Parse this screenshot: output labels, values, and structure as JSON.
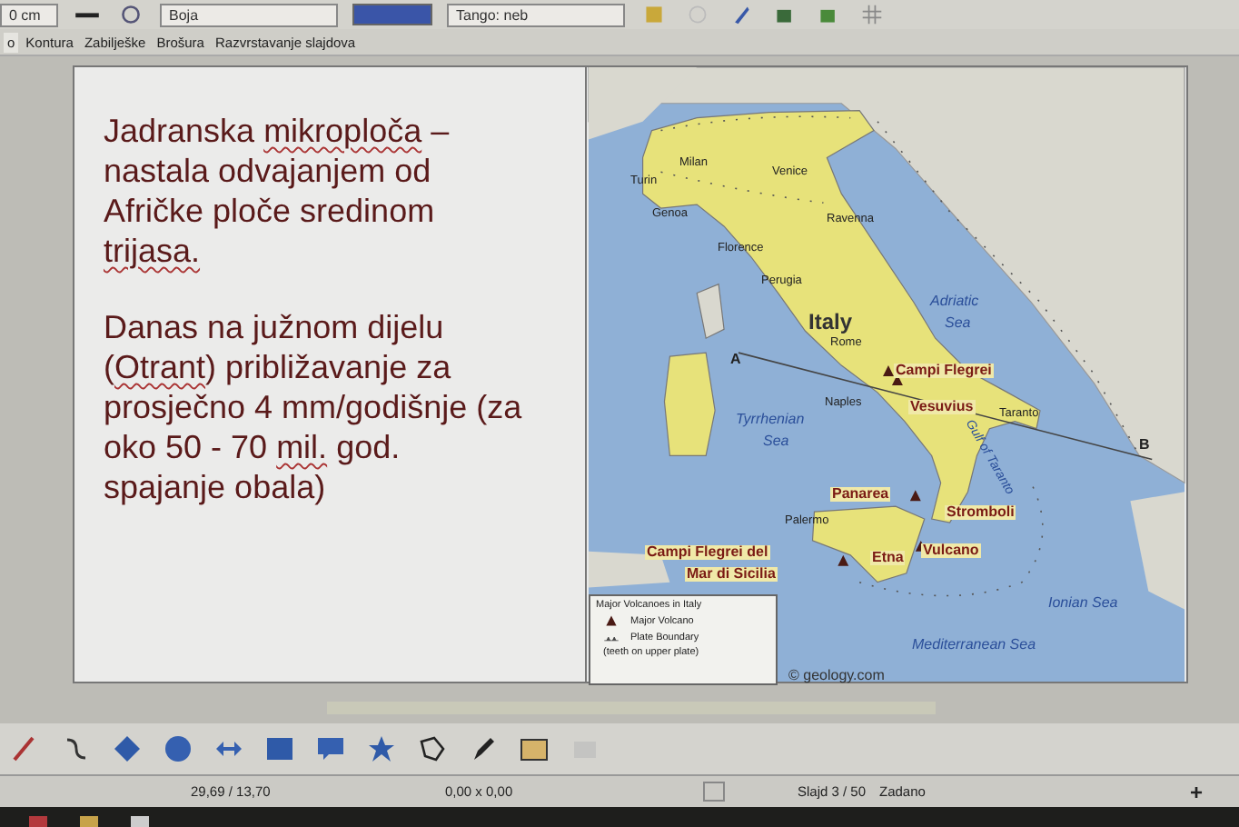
{
  "toolbar": {
    "width_field": "0 cm",
    "fill_field": "Boja",
    "color_field": "Tango: neb"
  },
  "view_tabs": [
    {
      "label": "o",
      "selected": true
    },
    {
      "label": "Kontura",
      "selected": false
    },
    {
      "label": "Zabilješke",
      "selected": false
    },
    {
      "label": "Brošura",
      "selected": false
    },
    {
      "label": "Razvrstavanje slajdova",
      "selected": false
    }
  ],
  "slide": {
    "paragraphs": [
      [
        {
          "text": "Jadranska ",
          "misspelled": false
        },
        {
          "text": "mikroploča",
          "misspelled": true
        },
        {
          "text": " – nastala odvajanjem od Afričke ploče sredinom ",
          "misspelled": false
        },
        {
          "text": "trijasa.",
          "misspelled": true
        }
      ],
      [
        {
          "text": "Danas na južnom dijelu (",
          "misspelled": false
        },
        {
          "text": "Otrant",
          "misspelled": true
        },
        {
          "text": ") približavanje za prosječno 4 mm/godišnje (za oko 50 - 70 ",
          "misspelled": false
        },
        {
          "text": "mil.",
          "misspelled": true
        },
        {
          "text": " god. spajanje obala)",
          "misspelled": false
        }
      ]
    ],
    "map": {
      "labels": [
        {
          "text": "Milan",
          "kind": "city"
        },
        {
          "text": "Venice",
          "kind": "city"
        },
        {
          "text": "Turin",
          "kind": "city"
        },
        {
          "text": "Genoa",
          "kind": "city"
        },
        {
          "text": "Ravenna",
          "kind": "city"
        },
        {
          "text": "Florence",
          "kind": "city"
        },
        {
          "text": "Perugia",
          "kind": "city"
        },
        {
          "text": "Italy",
          "kind": "country"
        },
        {
          "text": "Adriatic",
          "kind": "sea"
        },
        {
          "text": "Sea",
          "kind": "sea"
        },
        {
          "text": "Rome",
          "kind": "city"
        },
        {
          "text": "A",
          "kind": "point"
        },
        {
          "text": "Campi Flegrei",
          "kind": "volcano"
        },
        {
          "text": "Naples",
          "kind": "city"
        },
        {
          "text": "Vesuvius",
          "kind": "volcano"
        },
        {
          "text": "Taranto",
          "kind": "city"
        },
        {
          "text": "Tyrrhenian",
          "kind": "sea"
        },
        {
          "text": "Sea",
          "kind": "sea"
        },
        {
          "text": "Gulf of Taranto",
          "kind": "sea"
        },
        {
          "text": "B",
          "kind": "point"
        },
        {
          "text": "Panarea",
          "kind": "volcano"
        },
        {
          "text": "Stromboli",
          "kind": "volcano"
        },
        {
          "text": "Palermo",
          "kind": "city"
        },
        {
          "text": "Campi Flegrei del",
          "kind": "volcano"
        },
        {
          "text": "Mar di Sicilia",
          "kind": "volcano"
        },
        {
          "text": "Etna",
          "kind": "volcano"
        },
        {
          "text": "Vulcano",
          "kind": "volcano"
        },
        {
          "text": "Ionian Sea",
          "kind": "sea"
        },
        {
          "text": "Mediterranean Sea",
          "kind": "sea"
        }
      ],
      "legend": {
        "title": "Major Volcanoes in Italy",
        "volcano": "Major Volcano",
        "boundary": "Plate Boundary",
        "boundary_note": "(teeth on upper plate)"
      },
      "credit": "© geology.com"
    }
  },
  "status_bar": {
    "position": "29,69 / 13,70",
    "size": "0,00 x 0,00",
    "slide": "Slajd 3 / 50",
    "layout": "Zadano",
    "zoom_in": "+"
  }
}
